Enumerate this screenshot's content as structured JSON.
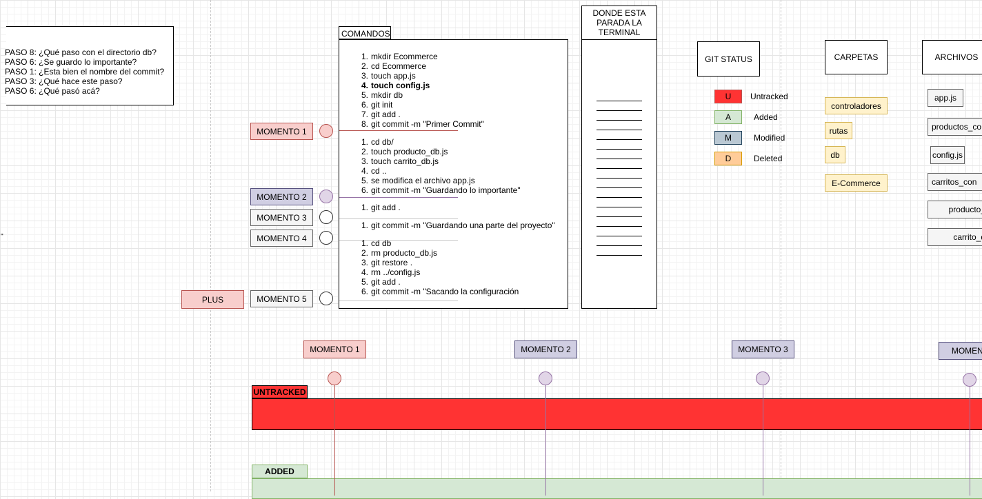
{
  "notes": {
    "lines": [
      "PASO 8: ¿Qué paso con el directorio db?",
      "PASO 6: ¿Se guardo lo importante?",
      "PASO 1: ¿Esta bien el nombre del commit?",
      "PASO 3: ¿Qué hace este paso?",
      "PASO 6: ¿Qué pasó acá?"
    ]
  },
  "left_glyph": "''",
  "comandos": {
    "title": "COMANDOS",
    "groups": [
      {
        "items": [
          "mkdir Ecommerce",
          "cd Ecommerce",
          "touch app.js",
          "touch config.js",
          "mkdir db",
          "git init",
          "git add .",
          "git commit -m \"Primer Commit\""
        ]
      },
      {
        "items": [
          "cd db/",
          "touch producto_db.js",
          "touch carrito_db.js",
          "cd ..",
          "se modifica el archivo app.js",
          "git commit -m \"Guardando lo importante\""
        ]
      },
      {
        "items": [
          "git add ."
        ]
      },
      {
        "items": [
          "git commit -m \"Guardando una parte del proyecto\""
        ]
      },
      {
        "items": [
          "cd db",
          "rm producto_db.js",
          "git restore .",
          "rm ../config.js",
          "git add .",
          "git commit -m \"Sacando la configuración"
        ]
      }
    ]
  },
  "momentos": [
    {
      "label": "MOMENTO 1",
      "fill": "#f8cecc",
      "border": "#b85450",
      "dot": "#f8cecc",
      "dot_border": "#b85450"
    },
    {
      "label": "MOMENTO 2",
      "fill": "#d0cee2",
      "border": "#56517e",
      "dot": "#e1d5e7",
      "dot_border": "#9673a6"
    },
    {
      "label": "MOMENTO 3",
      "fill": "#f5f5f5",
      "border": "#666666",
      "dot": "#ffffff",
      "dot_border": "#333333"
    },
    {
      "label": "MOMENTO 4",
      "fill": "#f5f5f5",
      "border": "#666666",
      "dot": "#ffffff",
      "dot_border": "#333333"
    },
    {
      "label": "MOMENTO 5",
      "fill": "#f5f5f5",
      "border": "#666666",
      "dot": "#ffffff",
      "dot_border": "#333333"
    }
  ],
  "plus": {
    "label": "PLUS",
    "fill": "#f8cecc",
    "border": "#b85450"
  },
  "terminal": {
    "title": "DONDE ESTA PARADA LA TERMINAL"
  },
  "git_status": {
    "title": "GIT STATUS",
    "items": [
      {
        "code": "U",
        "label": "Untracked",
        "fill": "#ff3333",
        "border": "#b85450"
      },
      {
        "code": "A",
        "label": "Added",
        "fill": "#d5e8d4",
        "border": "#82b366"
      },
      {
        "code": "M",
        "label": "Modified",
        "fill": "#bac8d3",
        "border": "#23445d"
      },
      {
        "code": "D",
        "label": "Deleted",
        "fill": "#ffcc99",
        "border": "#d79b00"
      }
    ]
  },
  "carpetas": {
    "title": "CARPETAS",
    "items": [
      "controladores",
      "rutas",
      "db",
      "E-Commerce"
    ],
    "fill": "#fff2cc",
    "border": "#d6b656"
  },
  "archivos": {
    "title": "ARCHIVOS",
    "items": [
      "app.js",
      "productos_co",
      "config.js",
      "carritos_con",
      "producto_",
      "carrito_d"
    ]
  },
  "timeline": {
    "momentos": [
      {
        "label": "MOMENTO 1",
        "fill": "#f8cecc",
        "border": "#b85450",
        "dot": "#f8cecc",
        "dot_border": "#b85450",
        "line": "#b85450"
      },
      {
        "label": "MOMENTO 2",
        "fill": "#d0cee2",
        "border": "#56517e",
        "dot": "#e1d5e7",
        "dot_border": "#9673a6",
        "line": "#9673a6"
      },
      {
        "label": "MOMENTO 3",
        "fill": "#d0cee2",
        "border": "#56517e",
        "dot": "#e1d5e7",
        "dot_border": "#9673a6",
        "line": "#9673a6"
      },
      {
        "label": "MOMENT",
        "fill": "#d0cee2",
        "border": "#56517e",
        "dot": "#e1d5e7",
        "dot_border": "#9673a6",
        "line": "#9673a6"
      }
    ],
    "lanes": [
      {
        "label": "UNTRACKED",
        "fill": "#ff3333",
        "border": "#b85450"
      },
      {
        "label": "ADDED",
        "fill": "#d5e8d4",
        "border": "#82b366"
      }
    ]
  }
}
